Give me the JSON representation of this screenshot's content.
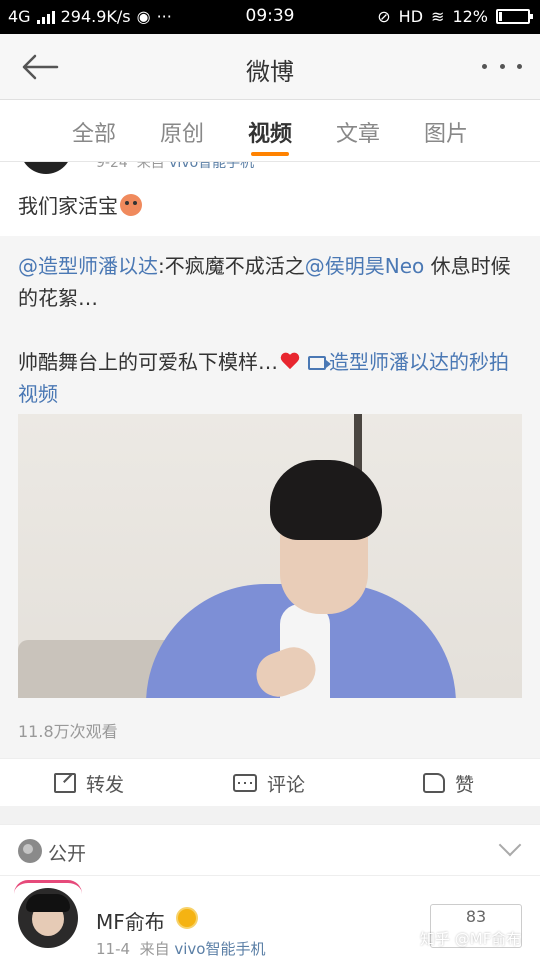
{
  "status_bar": {
    "network": "4G",
    "speed": "294.9K/s",
    "time": "09:39",
    "hd": "HD",
    "battery": "12%",
    "battery_level": 0.12
  },
  "nav": {
    "title": "微博"
  },
  "tabs": [
    {
      "label": "全部"
    },
    {
      "label": "原创"
    },
    {
      "label": "视频"
    },
    {
      "label": "文章"
    },
    {
      "label": "图片"
    }
  ],
  "active_tab": "视频",
  "accent_color": "#ff8200",
  "link_color": "#4a78b4",
  "post": {
    "date": "9-24",
    "source_prefix": "来自",
    "source": "vivo智能手机",
    "text": "我们家活宝",
    "repost": {
      "mention1": "@造型师潘以达",
      "text1": ":不疯魔不成活之",
      "mention2": "@侯明昊Neo",
      "text2": " 休息时候的花絮…",
      "text3": "帅酷舞台上的可爱私下模样…",
      "video_link": "造型师潘以达的秒拍视频"
    },
    "view_count": "11.8万次观看"
  },
  "actions": {
    "share": "转发",
    "comment": "评论",
    "like": "赞"
  },
  "privacy": {
    "label": "公开"
  },
  "comment": {
    "name": "MF俞布",
    "date": "11-4",
    "source_prefix": "来自",
    "source": "vivo智能手机",
    "count": "83"
  },
  "watermark": "知乎 @MF俞布"
}
